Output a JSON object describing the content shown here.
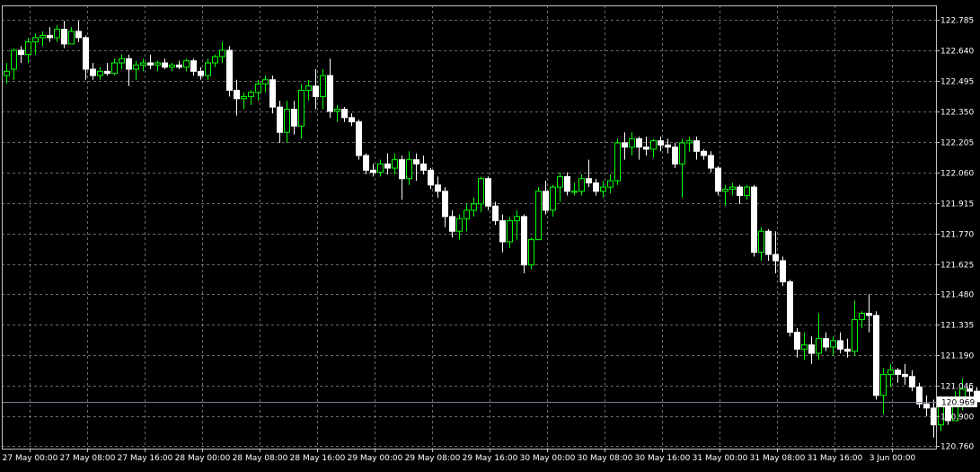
{
  "colors": {
    "background": "#000000",
    "grid": "#c0c0c0",
    "axis": "#c0c0c0",
    "text": "#ffffff",
    "bull_body": "#000000",
    "bull_outline": "#00ff00",
    "bear_body": "#ffffff",
    "bear_outline": "#ffffff",
    "current_price_line": "#708090",
    "current_price_box": "#ffffff"
  },
  "chart_data": {
    "type": "candlestick",
    "y_ticks": [
      "122.785",
      "122.640",
      "122.495",
      "122.350",
      "122.205",
      "122.060",
      "121.915",
      "121.770",
      "121.625",
      "121.480",
      "121.335",
      "121.190",
      "121.045",
      "120.900",
      "120.760"
    ],
    "ylim": [
      120.73,
      122.82
    ],
    "x_ticks": [
      "27 May 00:00",
      "27 May 08:00",
      "27 May 16:00",
      "28 May 00:00",
      "28 May 08:00",
      "28 May 16:00",
      "29 May 00:00",
      "29 May 08:00",
      "29 May 16:00",
      "30 May 00:00",
      "30 May 08:00",
      "30 May 16:00",
      "31 May 00:00",
      "31 May 08:00",
      "31 May 16:00",
      "3 Jun 00:00"
    ],
    "bars_per_x_tick": 8,
    "current_price": 120.969,
    "current_price_label": "120.969",
    "grid": true,
    "candles": [
      {
        "o": 122.52,
        "h": 122.58,
        "l": 122.48,
        "c": 122.54
      },
      {
        "o": 122.55,
        "h": 122.65,
        "l": 122.5,
        "c": 122.64
      },
      {
        "o": 122.64,
        "h": 122.66,
        "l": 122.58,
        "c": 122.62
      },
      {
        "o": 122.62,
        "h": 122.7,
        "l": 122.58,
        "c": 122.68
      },
      {
        "o": 122.68,
        "h": 122.72,
        "l": 122.62,
        "c": 122.7
      },
      {
        "o": 122.7,
        "h": 122.73,
        "l": 122.66,
        "c": 122.71
      },
      {
        "o": 122.71,
        "h": 122.75,
        "l": 122.68,
        "c": 122.7
      },
      {
        "o": 122.7,
        "h": 122.76,
        "l": 122.68,
        "c": 122.74
      },
      {
        "o": 122.74,
        "h": 122.78,
        "l": 122.65,
        "c": 122.67
      },
      {
        "o": 122.67,
        "h": 122.75,
        "l": 122.68,
        "c": 122.73
      },
      {
        "o": 122.73,
        "h": 122.78,
        "l": 122.68,
        "c": 122.7
      },
      {
        "o": 122.7,
        "h": 122.71,
        "l": 122.5,
        "c": 122.55
      },
      {
        "o": 122.55,
        "h": 122.58,
        "l": 122.5,
        "c": 122.52
      },
      {
        "o": 122.52,
        "h": 122.56,
        "l": 122.5,
        "c": 122.54
      },
      {
        "o": 122.54,
        "h": 122.58,
        "l": 122.52,
        "c": 122.53
      },
      {
        "o": 122.53,
        "h": 122.6,
        "l": 122.52,
        "c": 122.58
      },
      {
        "o": 122.58,
        "h": 122.62,
        "l": 122.55,
        "c": 122.6
      },
      {
        "o": 122.6,
        "h": 122.62,
        "l": 122.47,
        "c": 122.55
      },
      {
        "o": 122.55,
        "h": 122.59,
        "l": 122.5,
        "c": 122.57
      },
      {
        "o": 122.57,
        "h": 122.6,
        "l": 122.54,
        "c": 122.58
      },
      {
        "o": 122.58,
        "h": 122.62,
        "l": 122.55,
        "c": 122.57
      },
      {
        "o": 122.57,
        "h": 122.59,
        "l": 122.54,
        "c": 122.58
      },
      {
        "o": 122.58,
        "h": 122.6,
        "l": 122.55,
        "c": 122.56
      },
      {
        "o": 122.56,
        "h": 122.58,
        "l": 122.54,
        "c": 122.57
      },
      {
        "o": 122.57,
        "h": 122.59,
        "l": 122.55,
        "c": 122.56
      },
      {
        "o": 122.56,
        "h": 122.6,
        "l": 122.54,
        "c": 122.59
      },
      {
        "o": 122.59,
        "h": 122.6,
        "l": 122.52,
        "c": 122.54
      },
      {
        "o": 122.54,
        "h": 122.56,
        "l": 122.5,
        "c": 122.52
      },
      {
        "o": 122.52,
        "h": 122.6,
        "l": 122.5,
        "c": 122.58
      },
      {
        "o": 122.58,
        "h": 122.62,
        "l": 122.56,
        "c": 122.61
      },
      {
        "o": 122.61,
        "h": 122.68,
        "l": 122.58,
        "c": 122.64
      },
      {
        "o": 122.64,
        "h": 122.66,
        "l": 122.42,
        "c": 122.45
      },
      {
        "o": 122.45,
        "h": 122.5,
        "l": 122.33,
        "c": 122.41
      },
      {
        "o": 122.41,
        "h": 122.44,
        "l": 122.36,
        "c": 122.42
      },
      {
        "o": 122.42,
        "h": 122.45,
        "l": 122.38,
        "c": 122.44
      },
      {
        "o": 122.44,
        "h": 122.5,
        "l": 122.4,
        "c": 122.48
      },
      {
        "o": 122.48,
        "h": 122.52,
        "l": 122.44,
        "c": 122.5
      },
      {
        "o": 122.5,
        "h": 122.52,
        "l": 122.34,
        "c": 122.37
      },
      {
        "o": 122.37,
        "h": 122.4,
        "l": 122.2,
        "c": 122.25
      },
      {
        "o": 122.25,
        "h": 122.4,
        "l": 122.2,
        "c": 122.36
      },
      {
        "o": 122.36,
        "h": 122.4,
        "l": 122.24,
        "c": 122.28
      },
      {
        "o": 122.28,
        "h": 122.48,
        "l": 122.22,
        "c": 122.45
      },
      {
        "o": 122.45,
        "h": 122.5,
        "l": 122.4,
        "c": 122.47
      },
      {
        "o": 122.47,
        "h": 122.55,
        "l": 122.36,
        "c": 122.42
      },
      {
        "o": 122.42,
        "h": 122.55,
        "l": 122.36,
        "c": 122.52
      },
      {
        "o": 122.52,
        "h": 122.6,
        "l": 122.32,
        "c": 122.35
      },
      {
        "o": 122.35,
        "h": 122.38,
        "l": 122.3,
        "c": 122.36
      },
      {
        "o": 122.36,
        "h": 122.37,
        "l": 122.3,
        "c": 122.32
      },
      {
        "o": 122.32,
        "h": 122.34,
        "l": 122.28,
        "c": 122.3
      },
      {
        "o": 122.3,
        "h": 122.31,
        "l": 122.12,
        "c": 122.14
      },
      {
        "o": 122.14,
        "h": 122.15,
        "l": 122.05,
        "c": 122.07
      },
      {
        "o": 122.07,
        "h": 122.1,
        "l": 122.04,
        "c": 122.06
      },
      {
        "o": 122.06,
        "h": 122.12,
        "l": 122.04,
        "c": 122.1
      },
      {
        "o": 122.1,
        "h": 122.15,
        "l": 122.05,
        "c": 122.08
      },
      {
        "o": 122.08,
        "h": 122.15,
        "l": 122.05,
        "c": 122.12
      },
      {
        "o": 122.12,
        "h": 122.14,
        "l": 121.93,
        "c": 122.03
      },
      {
        "o": 122.03,
        "h": 122.16,
        "l": 122.0,
        "c": 122.12
      },
      {
        "o": 122.12,
        "h": 122.15,
        "l": 122.02,
        "c": 122.1
      },
      {
        "o": 122.1,
        "h": 122.14,
        "l": 122.05,
        "c": 122.07
      },
      {
        "o": 122.07,
        "h": 122.08,
        "l": 121.98,
        "c": 122.0
      },
      {
        "o": 122.0,
        "h": 122.04,
        "l": 121.94,
        "c": 121.97
      },
      {
        "o": 121.97,
        "h": 121.99,
        "l": 121.8,
        "c": 121.85
      },
      {
        "o": 121.85,
        "h": 121.88,
        "l": 121.75,
        "c": 121.78
      },
      {
        "o": 121.78,
        "h": 121.86,
        "l": 121.74,
        "c": 121.84
      },
      {
        "o": 121.84,
        "h": 121.91,
        "l": 121.78,
        "c": 121.88
      },
      {
        "o": 121.88,
        "h": 121.94,
        "l": 121.85,
        "c": 121.91
      },
      {
        "o": 121.91,
        "h": 122.04,
        "l": 121.87,
        "c": 122.03
      },
      {
        "o": 122.03,
        "h": 122.04,
        "l": 121.88,
        "c": 121.9
      },
      {
        "o": 121.9,
        "h": 121.92,
        "l": 121.81,
        "c": 121.83
      },
      {
        "o": 121.83,
        "h": 121.86,
        "l": 121.68,
        "c": 121.73
      },
      {
        "o": 121.73,
        "h": 121.85,
        "l": 121.7,
        "c": 121.83
      },
      {
        "o": 121.83,
        "h": 121.88,
        "l": 121.74,
        "c": 121.85
      },
      {
        "o": 121.85,
        "h": 121.86,
        "l": 121.58,
        "c": 121.62
      },
      {
        "o": 121.62,
        "h": 121.75,
        "l": 121.6,
        "c": 121.74
      },
      {
        "o": 121.74,
        "h": 121.99,
        "l": 121.74,
        "c": 121.97
      },
      {
        "o": 121.97,
        "h": 122.02,
        "l": 121.86,
        "c": 121.88
      },
      {
        "o": 121.88,
        "h": 122.0,
        "l": 121.85,
        "c": 121.99
      },
      {
        "o": 121.99,
        "h": 122.06,
        "l": 121.92,
        "c": 122.04
      },
      {
        "o": 122.04,
        "h": 122.06,
        "l": 121.95,
        "c": 121.97
      },
      {
        "o": 121.97,
        "h": 122.01,
        "l": 121.95,
        "c": 121.97
      },
      {
        "o": 121.97,
        "h": 122.05,
        "l": 121.95,
        "c": 122.03
      },
      {
        "o": 122.03,
        "h": 122.12,
        "l": 121.99,
        "c": 122.01
      },
      {
        "o": 122.01,
        "h": 122.03,
        "l": 121.95,
        "c": 121.97
      },
      {
        "o": 121.97,
        "h": 122.02,
        "l": 121.94,
        "c": 121.99
      },
      {
        "o": 121.99,
        "h": 122.05,
        "l": 121.96,
        "c": 122.02
      },
      {
        "o": 122.02,
        "h": 122.22,
        "l": 122.0,
        "c": 122.2
      },
      {
        "o": 122.2,
        "h": 122.25,
        "l": 122.12,
        "c": 122.18
      },
      {
        "o": 122.18,
        "h": 122.25,
        "l": 122.14,
        "c": 122.22
      },
      {
        "o": 122.22,
        "h": 122.23,
        "l": 122.12,
        "c": 122.18
      },
      {
        "o": 122.18,
        "h": 122.23,
        "l": 122.14,
        "c": 122.17
      },
      {
        "o": 122.17,
        "h": 122.22,
        "l": 122.13,
        "c": 122.21
      },
      {
        "o": 122.21,
        "h": 122.23,
        "l": 122.16,
        "c": 122.19
      },
      {
        "o": 122.19,
        "h": 122.22,
        "l": 122.15,
        "c": 122.18
      },
      {
        "o": 122.18,
        "h": 122.2,
        "l": 122.08,
        "c": 122.1
      },
      {
        "o": 122.1,
        "h": 122.22,
        "l": 121.94,
        "c": 122.2
      },
      {
        "o": 122.2,
        "h": 122.23,
        "l": 122.16,
        "c": 122.21
      },
      {
        "o": 122.21,
        "h": 122.23,
        "l": 122.12,
        "c": 122.16
      },
      {
        "o": 122.16,
        "h": 122.17,
        "l": 122.12,
        "c": 122.14
      },
      {
        "o": 122.14,
        "h": 122.16,
        "l": 122.06,
        "c": 122.08
      },
      {
        "o": 122.08,
        "h": 122.09,
        "l": 121.95,
        "c": 121.97
      },
      {
        "o": 121.97,
        "h": 122.0,
        "l": 121.9,
        "c": 121.98
      },
      {
        "o": 121.98,
        "h": 122.01,
        "l": 121.95,
        "c": 121.99
      },
      {
        "o": 121.99,
        "h": 122.0,
        "l": 121.91,
        "c": 121.95
      },
      {
        "o": 121.95,
        "h": 122.0,
        "l": 121.93,
        "c": 121.99
      },
      {
        "o": 121.99,
        "h": 122.0,
        "l": 121.66,
        "c": 121.68
      },
      {
        "o": 121.68,
        "h": 121.8,
        "l": 121.64,
        "c": 121.78
      },
      {
        "o": 121.78,
        "h": 121.79,
        "l": 121.64,
        "c": 121.67
      },
      {
        "o": 121.67,
        "h": 121.78,
        "l": 121.58,
        "c": 121.64
      },
      {
        "o": 121.64,
        "h": 121.66,
        "l": 121.52,
        "c": 121.54
      },
      {
        "o": 121.54,
        "h": 121.55,
        "l": 121.28,
        "c": 121.3
      },
      {
        "o": 121.3,
        "h": 121.32,
        "l": 121.18,
        "c": 121.22
      },
      {
        "o": 121.22,
        "h": 121.3,
        "l": 121.17,
        "c": 121.24
      },
      {
        "o": 121.24,
        "h": 121.28,
        "l": 121.15,
        "c": 121.2
      },
      {
        "o": 121.2,
        "h": 121.39,
        "l": 121.17,
        "c": 121.27
      },
      {
        "o": 121.27,
        "h": 121.3,
        "l": 121.21,
        "c": 121.23
      },
      {
        "o": 121.23,
        "h": 121.28,
        "l": 121.19,
        "c": 121.26
      },
      {
        "o": 121.26,
        "h": 121.3,
        "l": 121.2,
        "c": 121.22
      },
      {
        "o": 121.22,
        "h": 121.27,
        "l": 121.18,
        "c": 121.21
      },
      {
        "o": 121.21,
        "h": 121.45,
        "l": 121.19,
        "c": 121.36
      },
      {
        "o": 121.36,
        "h": 121.4,
        "l": 121.32,
        "c": 121.39
      },
      {
        "o": 121.39,
        "h": 121.48,
        "l": 121.3,
        "c": 121.38
      },
      {
        "o": 121.38,
        "h": 121.4,
        "l": 120.98,
        "c": 121.0
      },
      {
        "o": 121.0,
        "h": 121.13,
        "l": 120.91,
        "c": 121.1
      },
      {
        "o": 121.1,
        "h": 121.15,
        "l": 121.04,
        "c": 121.12
      },
      {
        "o": 121.12,
        "h": 121.13,
        "l": 121.06,
        "c": 121.1
      },
      {
        "o": 121.1,
        "h": 121.15,
        "l": 121.05,
        "c": 121.09
      },
      {
        "o": 121.09,
        "h": 121.12,
        "l": 121.02,
        "c": 121.04
      },
      {
        "o": 121.04,
        "h": 121.06,
        "l": 120.94,
        "c": 120.96
      },
      {
        "o": 120.96,
        "h": 121.0,
        "l": 120.9,
        "c": 120.94
      },
      {
        "o": 120.94,
        "h": 120.98,
        "l": 120.8,
        "c": 120.86
      },
      {
        "o": 120.86,
        "h": 120.97,
        "l": 120.83,
        "c": 120.95
      },
      {
        "o": 120.95,
        "h": 120.98,
        "l": 120.86,
        "c": 120.88
      },
      {
        "o": 120.88,
        "h": 121.02,
        "l": 120.88,
        "c": 120.96
      },
      {
        "o": 120.96,
        "h": 121.08,
        "l": 120.93,
        "c": 121.03
      },
      {
        "o": 121.03,
        "h": 121.05,
        "l": 120.95,
        "c": 121.02
      },
      {
        "o": 121.02,
        "h": 121.04,
        "l": 120.95,
        "c": 120.97
      },
      {
        "o": 120.97,
        "h": 121.0,
        "l": 120.93,
        "c": 120.95
      },
      {
        "o": 120.95,
        "h": 120.98,
        "l": 120.94,
        "c": 120.97
      }
    ]
  }
}
